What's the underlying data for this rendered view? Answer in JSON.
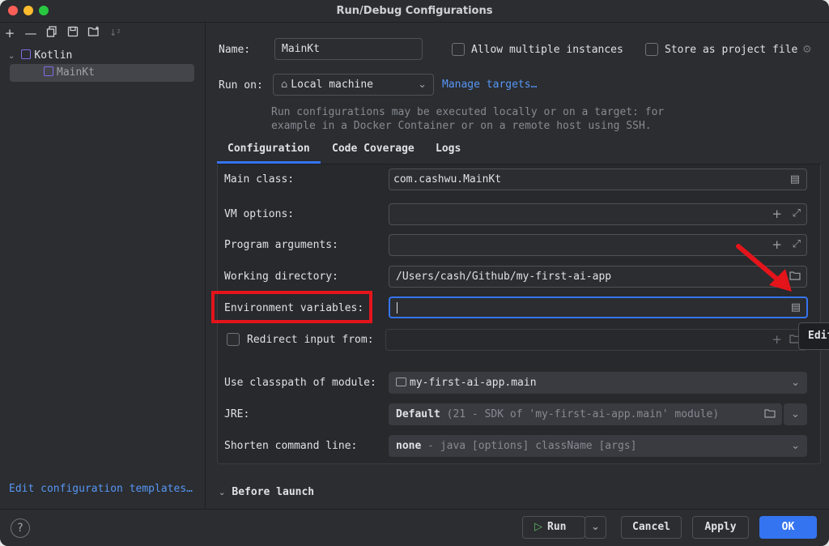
{
  "window": {
    "title": "Run/Debug Configurations"
  },
  "sidebar": {
    "tree": [
      {
        "label": "Kotlin",
        "expanded": true
      },
      {
        "label": "MainKt",
        "selected": true
      }
    ],
    "edit_templates_link": "Edit configuration templates…"
  },
  "form": {
    "name_label": "Name:",
    "name_value": "MainKt",
    "allow_multiple_label": "Allow multiple instances",
    "store_project_label": "Store as project file",
    "run_on_label": "Run on:",
    "run_on_value": "Local machine",
    "manage_targets_link": "Manage targets…",
    "run_on_hint_line1": "Run configurations may be executed locally or on a target: for",
    "run_on_hint_line2": "example in a Docker Container or on a remote host using SSH."
  },
  "tabs": [
    {
      "label": "Configuration",
      "active": true
    },
    {
      "label": "Code Coverage",
      "active": false
    },
    {
      "label": "Logs",
      "active": false
    }
  ],
  "configuration": {
    "main_class_label": "Main class:",
    "main_class_value": "com.cashwu.MainKt",
    "vm_options_label": "VM options:",
    "vm_options_value": "",
    "program_args_label": "Program arguments:",
    "program_args_value": "",
    "working_dir_label": "Working directory:",
    "working_dir_value": "/Users/cash/Github/my-first-ai-app",
    "env_vars_label": "Environment variables:",
    "env_vars_value": "",
    "redirect_input_label": "Redirect input from:",
    "classpath_label": "Use classpath of module:",
    "classpath_value": "my-first-ai-app.main",
    "jre_label": "JRE:",
    "jre_value": "Default",
    "jre_detail": "(21 - SDK of 'my-first-ai-app.main' module)",
    "shorten_label": "Shorten command line:",
    "shorten_value": "none",
    "shorten_detail": "- java [options] className [args]"
  },
  "before_launch_label": "Before launch",
  "tooltip_text": "Edit",
  "buttons": {
    "run": "Run",
    "cancel": "Cancel",
    "apply": "Apply",
    "ok": "OK",
    "help": "?"
  },
  "colors": {
    "accent": "#3574f0",
    "link": "#5796f5",
    "highlight": "#e4141b",
    "background": "#2b2d30"
  }
}
